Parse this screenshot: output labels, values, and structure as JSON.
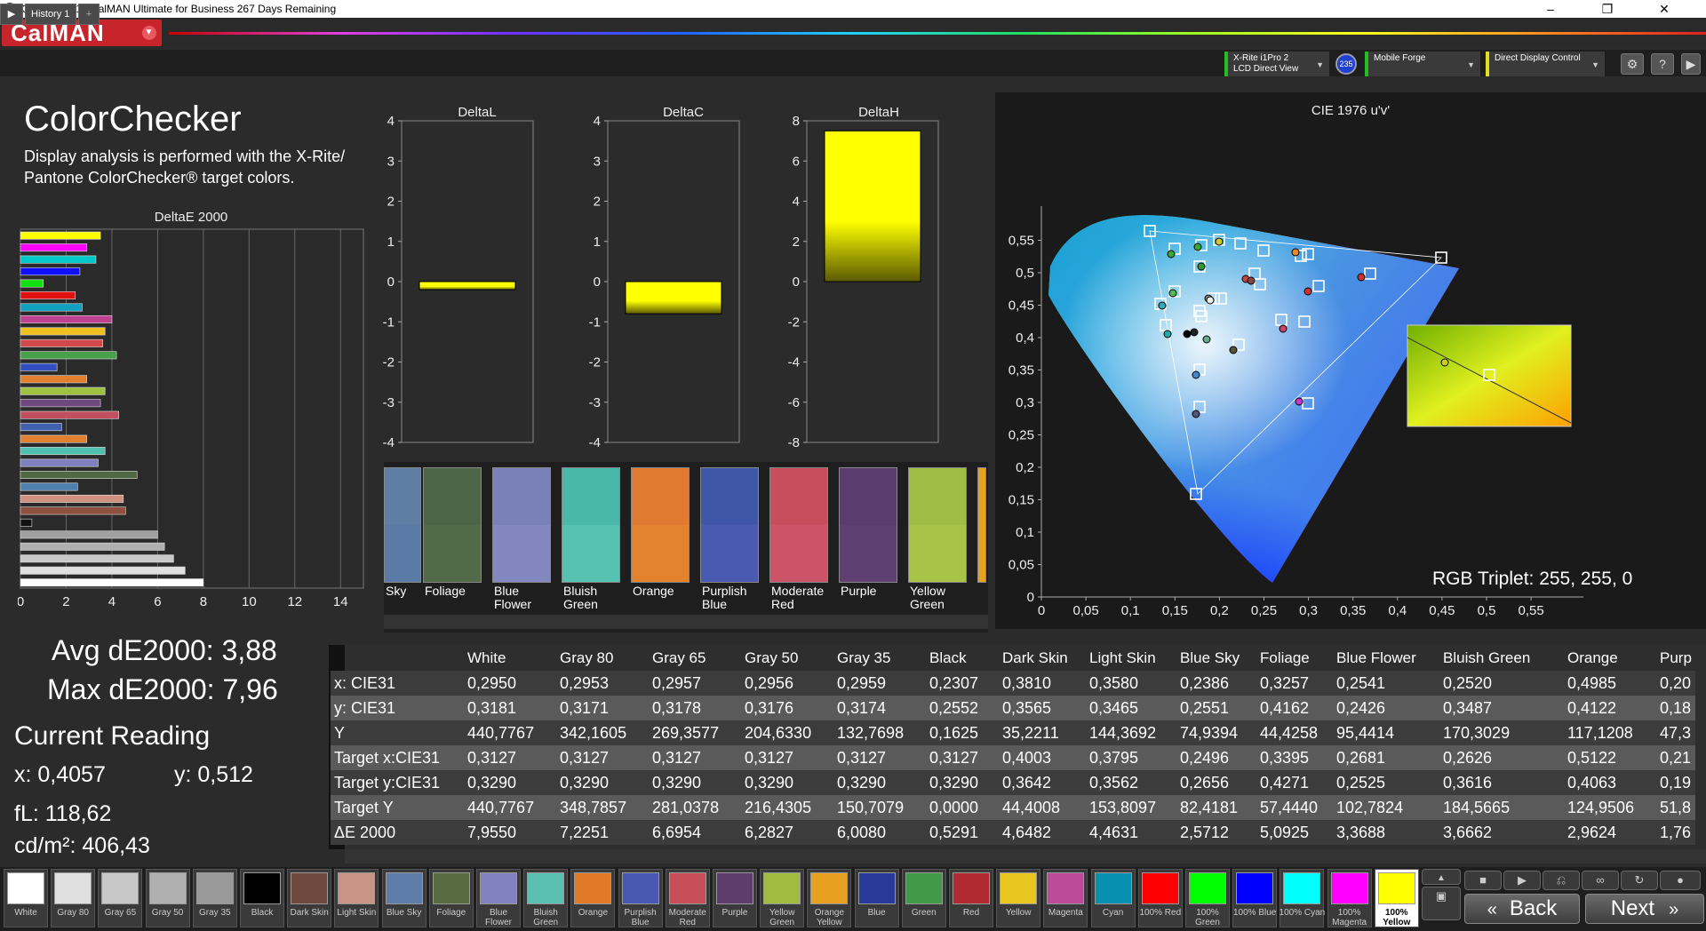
{
  "window": {
    "title": "CalMAN 2017 CalMAN Ultimate for Business 267 Days Remaining",
    "icon": "calman-logo-icon",
    "minimize": "–",
    "maximize": "❐",
    "close": "✕"
  },
  "brand": {
    "name": "CalMAN",
    "menu_glyph": "▼"
  },
  "tabs": {
    "history": "History 1",
    "add": "+",
    "play": "▶"
  },
  "devices": [
    {
      "line1": "X-Rite i1Pro 2",
      "line2": "LCD Direct View",
      "badge": "235",
      "color": "#20c020"
    },
    {
      "line1": "Mobile Forge",
      "line2": "",
      "color": "#20c020"
    },
    {
      "line1": "Direct Display Control",
      "line2": "",
      "color": "#e0e020"
    }
  ],
  "toolbar_icons": {
    "settings": "⚙",
    "help": "?",
    "more": "▶"
  },
  "page": {
    "title": "ColorChecker",
    "description": "Display analysis is performed with the X-Rite/ Pantone ColorChecker® target colors."
  },
  "deltae_chart": {
    "title": "DeltaE 2000",
    "xticks": [
      "0",
      "2",
      "4",
      "6",
      "8",
      "10",
      "12",
      "14"
    ],
    "xmax": 15,
    "bars": [
      {
        "v": 3.5,
        "c": "#ffff00"
      },
      {
        "v": 2.9,
        "c": "#ff00ff"
      },
      {
        "v": 3.3,
        "c": "#00c8c8"
      },
      {
        "v": 2.6,
        "c": "#1010ff"
      },
      {
        "v": 1.0,
        "c": "#10e010"
      },
      {
        "v": 2.4,
        "c": "#e01010"
      },
      {
        "v": 2.7,
        "c": "#10a0c0"
      },
      {
        "v": 4.0,
        "c": "#c04090"
      },
      {
        "v": 3.7,
        "c": "#f0c020"
      },
      {
        "v": 3.6,
        "c": "#d04848"
      },
      {
        "v": 4.2,
        "c": "#48a048"
      },
      {
        "v": 1.6,
        "c": "#3050c0"
      },
      {
        "v": 2.9,
        "c": "#e08030"
      },
      {
        "v": 3.7,
        "c": "#a0c040"
      },
      {
        "v": 3.5,
        "c": "#704880"
      },
      {
        "v": 4.3,
        "c": "#c05060"
      },
      {
        "v": 1.8,
        "c": "#4060b0"
      },
      {
        "v": 2.9,
        "c": "#e08030"
      },
      {
        "v": 3.7,
        "c": "#50c0b0"
      },
      {
        "v": 3.4,
        "c": "#8080c0"
      },
      {
        "v": 5.1,
        "c": "#506840"
      },
      {
        "v": 2.5,
        "c": "#5080b0"
      },
      {
        "v": 4.5,
        "c": "#d09080"
      },
      {
        "v": 4.6,
        "c": "#905040"
      },
      {
        "v": 0.5,
        "c": "#111111"
      },
      {
        "v": 6.0,
        "c": "#a0a0a0"
      },
      {
        "v": 6.3,
        "c": "#b0b0b0"
      },
      {
        "v": 6.7,
        "c": "#c8c8c8"
      },
      {
        "v": 7.2,
        "c": "#e0e0e0"
      },
      {
        "v": 8.0,
        "c": "#ffffff"
      }
    ]
  },
  "delta_charts": [
    {
      "title": "DeltaL",
      "ticks": [
        "4",
        "3",
        "2",
        "1",
        "0",
        "-1",
        "-2",
        "-3",
        "-4"
      ],
      "min": -4,
      "max": 4,
      "value": -0.2
    },
    {
      "title": "DeltaC",
      "ticks": [
        "4",
        "3",
        "2",
        "1",
        "0",
        "-1",
        "-2",
        "-3",
        "-4"
      ],
      "min": -4,
      "max": 4,
      "value": -0.8
    },
    {
      "title": "DeltaH",
      "ticks": [
        "8",
        "6",
        "4",
        "2",
        "0",
        "-2",
        "-4",
        "-6",
        "-8"
      ],
      "min": -8,
      "max": 8,
      "value": 7.5
    }
  ],
  "swatches": [
    {
      "top": "#5f7ea3",
      "bot": "#5a7ba5",
      "label": "Sky"
    },
    {
      "top": "#4d6445",
      "bot": "#526a48",
      "label": "Foliage"
    },
    {
      "top": "#7a80b8",
      "bot": "#8287c0",
      "label": "Blue Flower"
    },
    {
      "top": "#4ab8a8",
      "bot": "#58c2b0",
      "label": "Bluish Green"
    },
    {
      "top": "#e07a30",
      "bot": "#e4822e",
      "label": "Orange"
    },
    {
      "top": "#4057a8",
      "bot": "#4a5ab0",
      "label": "Purplish Blue"
    },
    {
      "top": "#c84e5e",
      "bot": "#cc5468",
      "label": "Moderate Red"
    },
    {
      "top": "#5a3c6e",
      "bot": "#603f72",
      "label": "Purple"
    },
    {
      "top": "#a0be44",
      "bot": "#a8c448",
      "label": "Yellow Green"
    }
  ],
  "cie": {
    "title": "CIE 1976 u'v'",
    "xticks": [
      "0",
      "0,05",
      "0,1",
      "0,15",
      "0,2",
      "0,25",
      "0,3",
      "0,35",
      "0,4",
      "0,45",
      "0,5",
      "0,55"
    ],
    "yticks": [
      "0,55",
      "0,5",
      "0,45",
      "0,4",
      "0,35",
      "0,3",
      "0,25",
      "0,2",
      "0,15",
      "0,1",
      "0,05",
      "0"
    ],
    "rgb_triplet": "RGB Triplet: 255, 255, 0"
  },
  "stats": {
    "avg": "Avg dE2000: 3,88",
    "max": "Max dE2000: 7,96",
    "current_reading": "Current Reading",
    "x": "x: 0,4057",
    "y": "y: 0,512",
    "fl": "fL: 118,62",
    "cdm2": "cd/m²: 406,43"
  },
  "table": {
    "headers": [
      "",
      "White",
      "Gray 80",
      "Gray 65",
      "Gray 50",
      "Gray 35",
      "Black",
      "Dark Skin",
      "Light Skin",
      "Blue Sky",
      "Foliage",
      "Blue Flower",
      "Bluish Green",
      "Orange",
      "Purp"
    ],
    "rows": [
      [
        "x: CIE31",
        "0,2950",
        "0,2953",
        "0,2957",
        "0,2956",
        "0,2959",
        "0,2307",
        "0,3810",
        "0,3580",
        "0,2386",
        "0,3257",
        "0,2541",
        "0,2520",
        "0,4985",
        "0,20"
      ],
      [
        "y: CIE31",
        "0,3181",
        "0,3171",
        "0,3178",
        "0,3176",
        "0,3174",
        "0,2552",
        "0,3565",
        "0,3465",
        "0,2551",
        "0,4162",
        "0,2426",
        "0,3487",
        "0,4122",
        "0,18"
      ],
      [
        "Y",
        "440,7767",
        "342,1605",
        "269,3577",
        "204,6330",
        "132,7698",
        "0,1625",
        "35,2211",
        "144,3692",
        "74,9394",
        "44,4258",
        "95,4414",
        "170,3029",
        "117,1208",
        "47,3"
      ],
      [
        "Target x:CIE31",
        "0,3127",
        "0,3127",
        "0,3127",
        "0,3127",
        "0,3127",
        "0,3127",
        "0,4003",
        "0,3795",
        "0,2496",
        "0,3395",
        "0,2681",
        "0,2626",
        "0,5122",
        "0,21"
      ],
      [
        "Target y:CIE31",
        "0,3290",
        "0,3290",
        "0,3290",
        "0,3290",
        "0,3290",
        "0,3290",
        "0,3642",
        "0,3562",
        "0,2656",
        "0,4271",
        "0,2525",
        "0,3616",
        "0,4063",
        "0,19"
      ],
      [
        "Target Y",
        "440,7767",
        "348,7857",
        "281,0378",
        "216,4305",
        "150,7079",
        "0,0000",
        "44,4008",
        "153,8097",
        "82,4181",
        "57,4440",
        "102,7824",
        "184,5665",
        "124,9506",
        "51,8"
      ],
      [
        "ΔE 2000",
        "7,9550",
        "7,2251",
        "6,6954",
        "6,2827",
        "6,0080",
        "0,5291",
        "4,6482",
        "4,4631",
        "2,5712",
        "5,0925",
        "3,3688",
        "3,6662",
        "2,9624",
        "1,76"
      ]
    ]
  },
  "bottom_swatches": [
    {
      "c": "#ffffff",
      "l": "White"
    },
    {
      "c": "#e0e0e0",
      "l": "Gray 80"
    },
    {
      "c": "#c8c8c8",
      "l": "Gray 65"
    },
    {
      "c": "#b0b0b0",
      "l": "Gray 50"
    },
    {
      "c": "#999999",
      "l": "Gray 35"
    },
    {
      "c": "#000000",
      "l": "Black"
    },
    {
      "c": "#6e4a3e",
      "l": "Dark Skin"
    },
    {
      "c": "#c89484",
      "l": "Light Skin"
    },
    {
      "c": "#5e7ca8",
      "l": "Blue Sky"
    },
    {
      "c": "#566c40",
      "l": "Foliage"
    },
    {
      "c": "#8282c0",
      "l": "Blue Flower"
    },
    {
      "c": "#5cc0b0",
      "l": "Bluish Green"
    },
    {
      "c": "#e07a28",
      "l": "Orange"
    },
    {
      "c": "#4858b0",
      "l": "Purplish Blue"
    },
    {
      "c": "#c84e5a",
      "l": "Moderate Red"
    },
    {
      "c": "#5e3c6c",
      "l": "Purple"
    },
    {
      "c": "#a0bc40",
      "l": "Yellow Green"
    },
    {
      "c": "#e8a020",
      "l": "Orange Yellow"
    },
    {
      "c": "#283a98",
      "l": "Blue"
    },
    {
      "c": "#409a48",
      "l": "Green"
    },
    {
      "c": "#b02a30",
      "l": "Red"
    },
    {
      "c": "#e8c820",
      "l": "Yellow"
    },
    {
      "c": "#bc4a98",
      "l": "Magenta"
    },
    {
      "c": "#0890b0",
      "l": "Cyan"
    },
    {
      "c": "#ff0000",
      "l": "100% Red"
    },
    {
      "c": "#00ff00",
      "l": "100% Green"
    },
    {
      "c": "#0000ff",
      "l": "100% Blue"
    },
    {
      "c": "#00ffff",
      "l": "100% Cyan"
    },
    {
      "c": "#ff00ff",
      "l": "100% Magenta"
    },
    {
      "c": "#ffff00",
      "l": "100% Yellow"
    }
  ],
  "nav": {
    "back": "Back",
    "next": "Next",
    "back_glyph": "«",
    "next_glyph": "»"
  }
}
